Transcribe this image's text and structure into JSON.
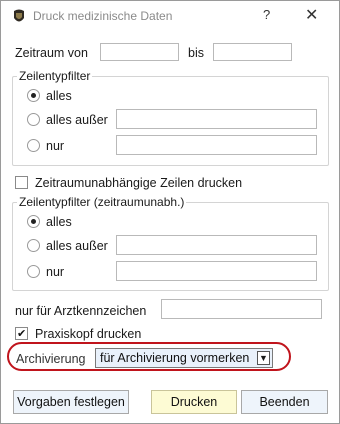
{
  "window": {
    "title": "Druck medizinische Daten",
    "help_label": "?",
    "close_label": "✕"
  },
  "zeitraum": {
    "von_label": "Zeitraum von",
    "von_value": "",
    "bis_label": "bis",
    "bis_value": ""
  },
  "zeilentypfilter": {
    "legend": "Zeilentypfilter",
    "options": [
      "alles",
      "alles außer",
      "nur"
    ],
    "selected": "alles",
    "ausser_value": "",
    "nur_value": ""
  },
  "zeitraumunabhaengig": {
    "checkbox_label": "Zeitraumunabhängige Zeilen drucken",
    "checked": false
  },
  "zeilentypfilter_unabh": {
    "legend": "Zeilentypfilter (zeitraumunabh.)",
    "options": [
      "alles",
      "alles außer",
      "nur"
    ],
    "selected": "alles",
    "ausser_value": "",
    "nur_value": ""
  },
  "arztkennzeichen": {
    "label": "nur für Arztkennzeichen",
    "value": ""
  },
  "praxiskopf": {
    "label": "Praxiskopf drucken",
    "checked": true
  },
  "archivierung": {
    "label": "Archivierung",
    "selected_value": "für Archivierung vormerken"
  },
  "buttons": {
    "vorgaben": "Vorgaben festlegen",
    "drucken": "Drucken",
    "beenden": "Beenden"
  },
  "colors": {
    "highlight": "#c0141c",
    "primary_button": "#fdfbd4",
    "button": "#eef4fb"
  }
}
